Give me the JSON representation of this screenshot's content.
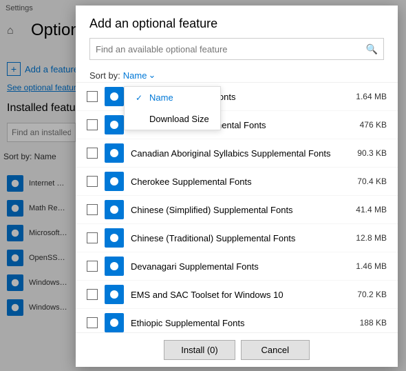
{
  "settings": {
    "window_title": "Settings",
    "page_title": "Optional",
    "add_feature_label": "Add a feature",
    "see_optional_link": "See optional feature hi...",
    "installed_features_title": "Installed features",
    "installed_search_placeholder": "Find an installed opti...",
    "sort_by_label": "Sort by: Name",
    "sort_by_prefix": "Sort by:",
    "sort_by_value": "Name"
  },
  "installed_items": [
    {
      "label": "Internet Explore..."
    },
    {
      "label": "Math Recognize..."
    },
    {
      "label": "Microsoft Quick..."
    },
    {
      "label": "OpenSSH Clien..."
    },
    {
      "label": "Windows Hello ..."
    },
    {
      "label": "Windows Media..."
    }
  ],
  "modal": {
    "title": "Add an optional feature",
    "search_placeholder": "Find an available optional feature",
    "sortby_label": "Sort by:",
    "sortby_value": "Name",
    "dropdown": {
      "options": [
        {
          "label": "Name",
          "active": true
        },
        {
          "label": "Download Size",
          "active": false
        }
      ]
    },
    "features": [
      {
        "name": "Script Supplemental Fonts",
        "size": "1.64 MB"
      },
      {
        "name": "Bangla Script Supplemental Fonts",
        "size": "476 KB"
      },
      {
        "name": "Canadian Aboriginal Syllabics Supplemental Fonts",
        "size": "90.3 KB"
      },
      {
        "name": "Cherokee Supplemental Fonts",
        "size": "70.4 KB"
      },
      {
        "name": "Chinese (Simplified) Supplemental Fonts",
        "size": "41.4 MB"
      },
      {
        "name": "Chinese (Traditional) Supplemental Fonts",
        "size": "12.8 MB"
      },
      {
        "name": "Devanagari Supplemental Fonts",
        "size": "1.46 MB"
      },
      {
        "name": "EMS and SAC Toolset for Windows 10",
        "size": "70.2 KB"
      },
      {
        "name": "Ethiopic Supplemental Fonts",
        "size": "188 KB"
      }
    ],
    "footer": {
      "install_label": "Install (0)",
      "cancel_label": "Cancel"
    }
  },
  "colors": {
    "accent": "#0078d7",
    "bg": "#f2f2f2",
    "modal_bg": "#ffffff"
  }
}
